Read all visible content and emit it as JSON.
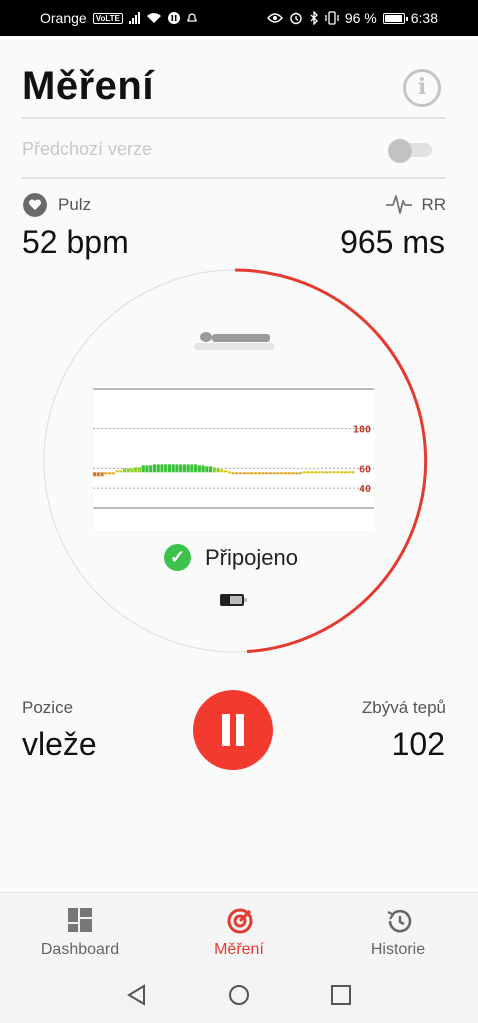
{
  "status_bar": {
    "carrier": "Orange",
    "volte": "VoLTE",
    "battery_percent": "96 %",
    "time": "6:38"
  },
  "header": {
    "title": "Měření",
    "info_icon": "info-icon"
  },
  "previous_version": {
    "label": "Předchozí verze",
    "enabled": false
  },
  "metrics": {
    "pulse_label": "Pulz",
    "pulse_value": "52 bpm",
    "rr_label": "RR",
    "rr_value": "965 ms"
  },
  "progress": {
    "fraction": 0.49,
    "color": "#e53a2e"
  },
  "chart_data": {
    "type": "bar",
    "y_ticks": [
      "100",
      "60",
      "40"
    ],
    "ylim": [
      20,
      140
    ],
    "values": [
      52,
      52,
      52,
      55,
      55,
      55,
      58,
      58,
      60,
      60,
      60,
      61,
      61,
      63,
      63,
      63,
      64,
      64,
      64,
      64,
      64,
      64,
      64,
      64,
      64,
      64,
      64,
      64,
      63,
      63,
      62,
      62,
      61,
      60,
      59,
      58,
      57,
      56,
      56,
      55,
      55,
      55,
      55,
      54,
      54,
      54,
      54,
      54,
      54,
      55,
      55,
      55,
      55,
      56,
      56,
      56,
      57,
      57,
      57,
      57,
      57,
      57,
      57,
      57,
      57,
      57,
      57,
      57,
      57,
      57
    ]
  },
  "connection": {
    "status": "Připojeno"
  },
  "session": {
    "position_label": "Pozice",
    "position_value": "vleže",
    "remaining_label": "Zbývá tepů",
    "remaining_value": "102"
  },
  "bottom_nav": {
    "items": [
      {
        "label": "Dashboard",
        "icon": "dashboard-icon",
        "active": false
      },
      {
        "label": "Měření",
        "icon": "measure-icon",
        "active": true
      },
      {
        "label": "Historie",
        "icon": "history-icon",
        "active": false
      }
    ]
  }
}
